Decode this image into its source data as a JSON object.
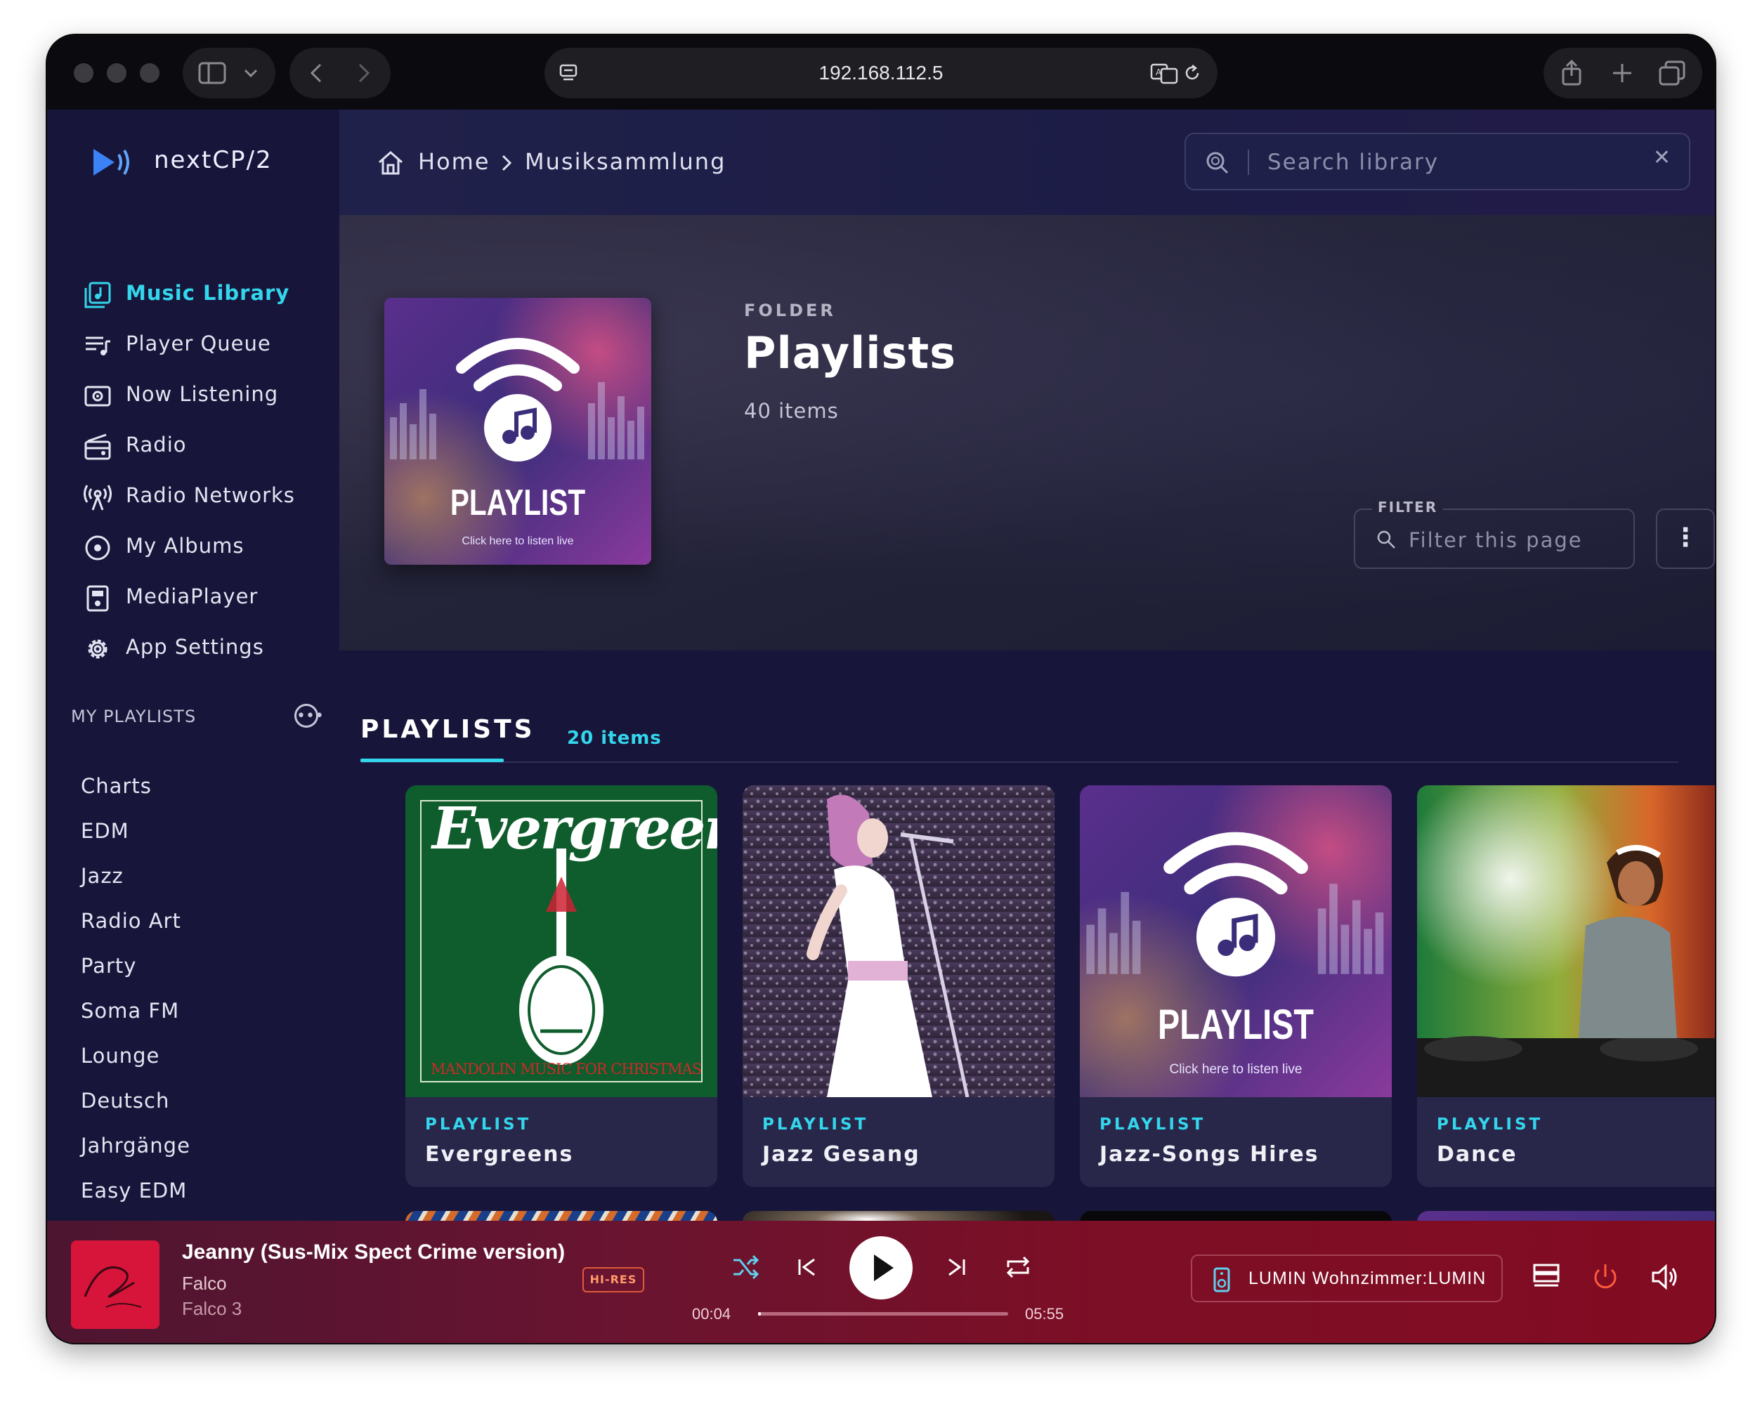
{
  "browser": {
    "url": "192.168.112.5"
  },
  "app": {
    "logo_text": "nextCP/2"
  },
  "nav": {
    "items": [
      {
        "label": "Music Library",
        "icon": "music-library-icon",
        "active": true
      },
      {
        "label": "Player Queue",
        "icon": "queue-icon"
      },
      {
        "label": "Now Listening",
        "icon": "now-listening-icon"
      },
      {
        "label": "Radio",
        "icon": "radio-icon"
      },
      {
        "label": "Radio Networks",
        "icon": "antenna-icon"
      },
      {
        "label": "My Albums",
        "icon": "disc-icon"
      },
      {
        "label": "MediaPlayer",
        "icon": "speaker-icon"
      },
      {
        "label": "App Settings",
        "icon": "gear-icon"
      }
    ]
  },
  "my_playlists": {
    "title": "MY PLAYLISTS",
    "items": [
      "Charts",
      "EDM",
      "Jazz",
      "Radio Art",
      "Party",
      "Soma FM",
      "Lounge",
      "Deutsch",
      "Jahrgänge",
      "Easy EDM"
    ]
  },
  "breadcrumb": {
    "home": "Home",
    "current": "Musiksammlung"
  },
  "search": {
    "placeholder": "Search library"
  },
  "hero": {
    "type_label": "FOLDER",
    "title": "Playlists",
    "count": "40 items",
    "art_text": "PLAYLIST",
    "art_subtext": "Click here to listen live"
  },
  "filter": {
    "legend": "FILTER",
    "placeholder": "Filter this page"
  },
  "playlists_section": {
    "title": "PLAYLISTS",
    "count": "20 items",
    "cards": [
      {
        "type": "PLAYLIST",
        "name": "Evergreens",
        "art_title": "Evergreen",
        "art_caption": "MANDOLIN MUSIC FOR CHRISTMAS"
      },
      {
        "type": "PLAYLIST",
        "name": "Jazz Gesang"
      },
      {
        "type": "PLAYLIST",
        "name": "Jazz-Songs Hires",
        "art_text": "PLAYLIST",
        "art_subtext": "Click here to listen live"
      },
      {
        "type": "PLAYLIST",
        "name": "Dance"
      }
    ]
  },
  "player": {
    "title": "Jeanny (Sus-Mix Spect Crime version)",
    "artist": "Falco",
    "album": "Falco 3",
    "quality_badge": "HI-RES",
    "elapsed": "00:04",
    "duration": "05:55",
    "progress": 0.012,
    "renderer": "LUMIN Wohnzimmer:LUMIN"
  },
  "colors": {
    "accent": "#33d6ec",
    "sidebar_bg": "#17163a",
    "player_bg": "#7d0e25",
    "power_icon": "#ff5a3c"
  }
}
